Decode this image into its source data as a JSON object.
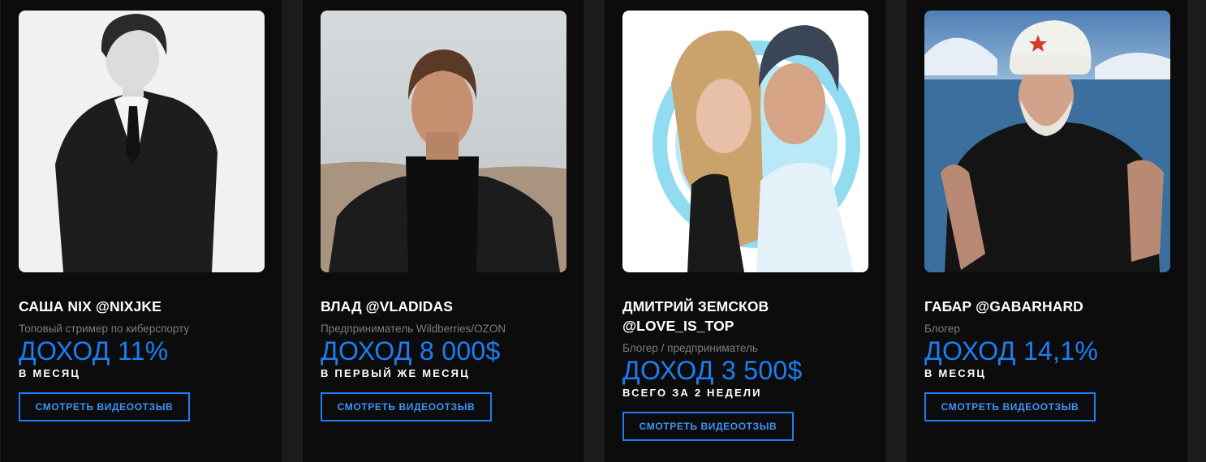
{
  "cards": [
    {
      "name": "САША NIX @NIXJKE",
      "role": "Топовый стример по киберспорту",
      "income": "ДОХОД 11%",
      "period": "В МЕСЯЦ",
      "button": "СМОТРЕТЬ ВИДЕООТЗЫВ"
    },
    {
      "name": "ВЛАД @VLADIDAS",
      "role": "Предприниматель Wildberries/OZON",
      "income": "ДОХОД 8 000$",
      "period": "В ПЕРВЫЙ ЖЕ МЕСЯЦ",
      "button": "СМОТРЕТЬ ВИДЕООТЗЫВ"
    },
    {
      "name_line1": "ДМИТРИЙ ЗЕМСКОВ",
      "name_line2": "@LOVE_IS_TOP",
      "role": "Блогер / предприниматель",
      "income": "ДОХОД 3 500$",
      "period": "ВСЕГО ЗА 2 НЕДЕЛИ",
      "button": "СМОТРЕТЬ ВИДЕООТЗЫВ"
    },
    {
      "name": "ГАБАР @GABARHARD",
      "role": "Блогер",
      "income": "ДОХОД 14,1%",
      "period": "В МЕСЯЦ",
      "button": "СМОТРЕТЬ ВИДЕООТЗЫВ"
    }
  ],
  "colors": {
    "accent": "#1d7ef2",
    "card_bg": "#0c0c0d",
    "page_bg": "#1b1b1d"
  }
}
